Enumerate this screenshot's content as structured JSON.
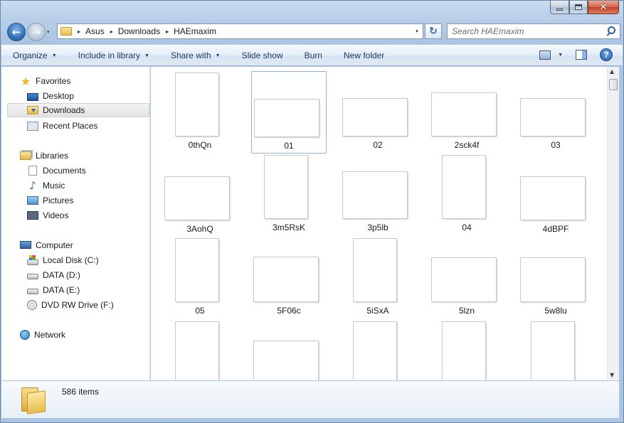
{
  "window": {
    "minimize_label": "–",
    "maximize_label": "□",
    "close_label": "✕"
  },
  "address_bar": {
    "crumbs": [
      "Asus",
      "Downloads",
      "HAEmaxim"
    ],
    "separator": "▸",
    "dropdown": "▾"
  },
  "nav_buttons": {
    "back": "←",
    "forward": "→",
    "history": "▾"
  },
  "refresh_glyph": "↻",
  "search": {
    "placeholder": "Search HAEmaxim",
    "icon": "search-icon"
  },
  "toolbar": {
    "organize": "Organize",
    "include_in_library": "Include in library",
    "share_with": "Share with",
    "slide_show": "Slide show",
    "burn": "Burn",
    "new_folder": "New folder",
    "caret": "▼",
    "help": "?"
  },
  "nav_pane": {
    "favorites": {
      "label": "Favorites",
      "items": [
        "Desktop",
        "Downloads",
        "Recent Places"
      ],
      "selected": "Downloads"
    },
    "libraries": {
      "label": "Libraries",
      "items": [
        "Documents",
        "Music",
        "Pictures",
        "Videos"
      ]
    },
    "computer": {
      "label": "Computer",
      "items": [
        "Local Disk (C:)",
        "DATA (D:)",
        "DATA (E:)",
        "DVD RW Drive (F:)"
      ]
    },
    "network": {
      "label": "Network"
    }
  },
  "files": [
    {
      "name": "0thQn",
      "palette": [
        "#1a1a1a",
        "#5a4a3a",
        "#e8e2d8"
      ]
    },
    {
      "name": "01",
      "palette": [
        "#7ac4ea",
        "#e8e0d8",
        "#3a5f8f"
      ],
      "selected": true
    },
    {
      "name": "02",
      "palette": [
        "#5fb0e2",
        "#e0d6ca",
        "#324d6e"
      ]
    },
    {
      "name": "2sck4f",
      "palette": [
        "#2a2a2a",
        "#d8cfc2",
        "#6fa8d8"
      ]
    },
    {
      "name": "03",
      "palette": [
        "#6fc0ea",
        "#e2dad0",
        "#2e4a70"
      ]
    },
    {
      "name": "3AohQ",
      "palette": [
        "#3a3a3a",
        "#d8d0c6",
        "#1c1c1c"
      ]
    },
    {
      "name": "3m5RsK",
      "palette": [
        "#c8c0b8",
        "#9ad0e8",
        "#4a4038"
      ]
    },
    {
      "name": "3p5lb",
      "palette": [
        "#050505",
        "#cfd8c8",
        "#111111"
      ]
    },
    {
      "name": "04",
      "palette": [
        "#4a3a4a",
        "#e8d8d0",
        "#8a6a7a"
      ]
    },
    {
      "name": "4dBPF",
      "palette": [
        "#1c1412",
        "#e6e2dc",
        "#3a2a22"
      ]
    },
    {
      "name": "05",
      "palette": [
        "#9a5a8a",
        "#e8d6c8",
        "#6a3a5a"
      ]
    },
    {
      "name": "5F06c",
      "palette": [
        "#0a0a0a",
        "#d0d8d0",
        "#2a3a5a"
      ]
    },
    {
      "name": "5iSxA",
      "palette": [
        "#0e1418",
        "#c8c8b8",
        "#4a5a4a"
      ]
    },
    {
      "name": "5lzn",
      "palette": [
        "#1a1a1a",
        "#eeeeee",
        "#5a5a5a"
      ]
    },
    {
      "name": "5w8lu",
      "palette": [
        "#1a2a5a",
        "#4a7ad8",
        "#d8d0c8"
      ]
    },
    {
      "name": "",
      "palette": [
        "#a05a90",
        "#e0d0c8",
        "#6a3a6a"
      ]
    },
    {
      "name": "",
      "palette": [
        "#b090d0",
        "#e8d8f0",
        "#6a5a8a"
      ]
    },
    {
      "name": "",
      "palette": [
        "#9a6ab8",
        "#e0c8e8",
        "#4a3a5a"
      ]
    },
    {
      "name": "",
      "palette": [
        "#a85a90",
        "#e6d4c8",
        "#6a3a5a"
      ]
    },
    {
      "name": "",
      "palette": [
        "#1a1820",
        "#e8e4e0",
        "#5a4a5a"
      ]
    }
  ],
  "details_pane": {
    "item_count": "586 items"
  },
  "scrollbar": {
    "up": "▲",
    "down": "▼"
  }
}
